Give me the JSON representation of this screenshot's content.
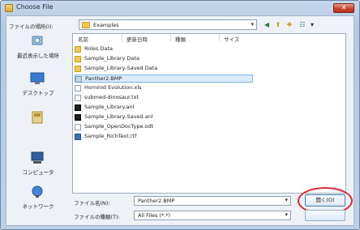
{
  "window": {
    "title": "Choose File"
  },
  "lookin": {
    "label": "ファイルの場所(I):",
    "value": "Examples"
  },
  "places": [
    {
      "label": "最近表示した場所",
      "icon": "recent-places-icon"
    },
    {
      "label": "デスクトップ",
      "icon": "desktop-icon"
    },
    {
      "label": "",
      "icon": "libraries-icon"
    },
    {
      "label": "コンピュータ",
      "icon": "computer-icon"
    },
    {
      "label": "ネットワーク",
      "icon": "network-icon"
    }
  ],
  "columns": {
    "name": "名前",
    "date": "更新日時",
    "type": "種類",
    "size": "サイズ"
  },
  "files": [
    {
      "name": "Roles Data",
      "icon": "folder-icon"
    },
    {
      "name": "Sample_Library Data",
      "icon": "folder-icon"
    },
    {
      "name": "Sample_Library-Saved Data",
      "icon": "folder-icon"
    },
    {
      "name": "Panther2.BMP",
      "icon": "bitmap-file-icon",
      "selected": true
    },
    {
      "name": "Hominid Evolution.xls",
      "icon": "spreadsheet-file-icon"
    },
    {
      "name": "submed-dinosaur.txt",
      "icon": "text-file-icon"
    },
    {
      "name": "Sample_Library.anl",
      "icon": "analysis-file-icon"
    },
    {
      "name": "Sample_Library-Saved.anl",
      "icon": "analysis-file-icon"
    },
    {
      "name": "Sample_OpenDocType.odt",
      "icon": "document-file-icon"
    },
    {
      "name": "Sample_RichText.rtf",
      "icon": "richtext-file-icon"
    }
  ],
  "filename": {
    "label": "ファイル名(N):",
    "value": "Panther2.BMP"
  },
  "filetype": {
    "label": "ファイルの種類(T):",
    "value": "All Files (*.*)"
  },
  "buttons": {
    "open": "開く(O)"
  },
  "colors": {
    "highlight_ring": "#e0252b",
    "folder": "#f2c94c",
    "selection": "#dcebfb"
  }
}
